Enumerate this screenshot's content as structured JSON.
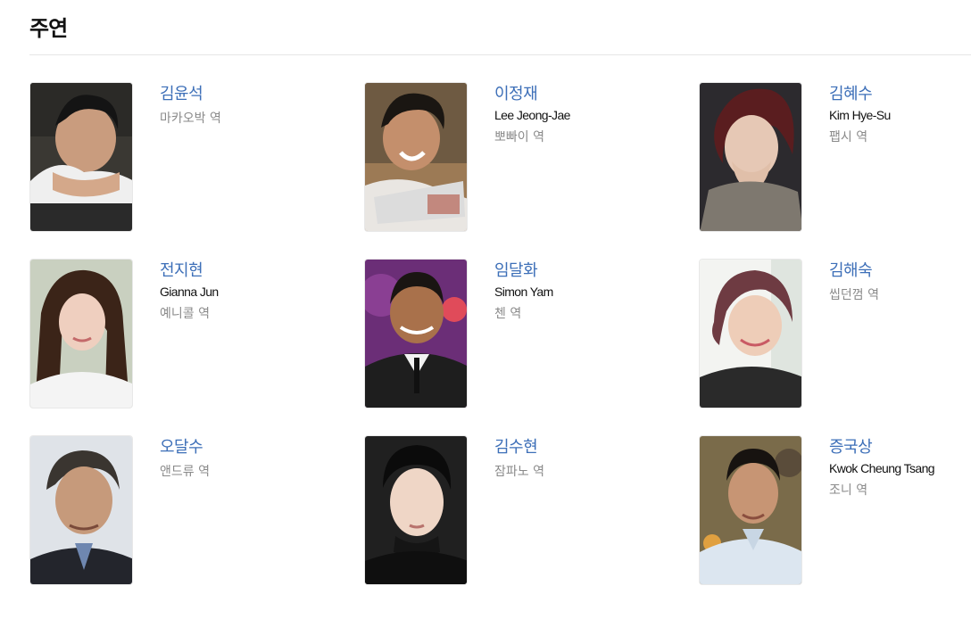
{
  "section": {
    "title": "주연"
  },
  "cast": [
    {
      "name": "김윤석",
      "english_name": "",
      "role": "마카오박 역"
    },
    {
      "name": "이정재",
      "english_name": "Lee Jeong-Jae",
      "role": "뽀빠이 역"
    },
    {
      "name": "김혜수",
      "english_name": "Kim Hye-Su",
      "role": "팹시 역"
    },
    {
      "name": "전지현",
      "english_name": "Gianna Jun",
      "role": "예니콜 역"
    },
    {
      "name": "임달화",
      "english_name": "Simon Yam",
      "role": "첸 역"
    },
    {
      "name": "김해숙",
      "english_name": "",
      "role": "씹던껌 역"
    },
    {
      "name": "오달수",
      "english_name": "",
      "role": "앤드류 역"
    },
    {
      "name": "김수현",
      "english_name": "",
      "role": "잠파노 역"
    },
    {
      "name": "증국상",
      "english_name": "Kwok Cheung Tsang",
      "role": "조니 역"
    }
  ]
}
